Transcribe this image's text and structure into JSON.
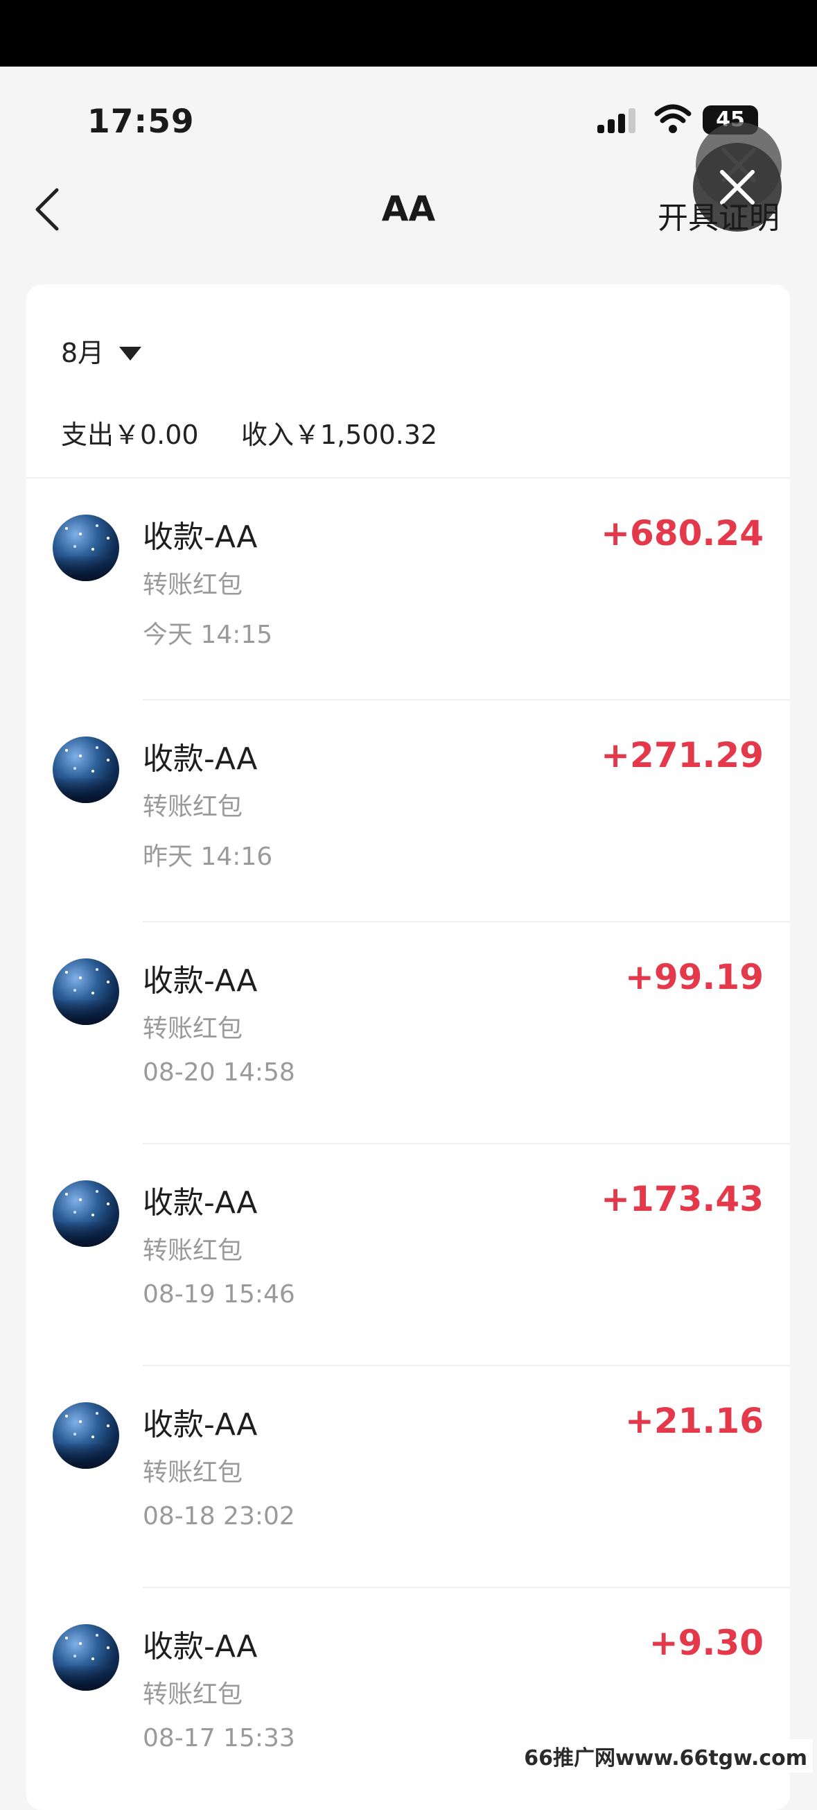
{
  "status_bar": {
    "time": "17:59",
    "battery": "45",
    "icons": [
      "signal-icon",
      "wifi-icon",
      "battery-icon"
    ]
  },
  "overlay": {
    "close_icon": "close-icon"
  },
  "nav": {
    "back_icon": "chevron-left-icon",
    "title": "AA",
    "action_label": "开具证明"
  },
  "filter": {
    "month_label": "8月",
    "caret_icon": "caret-down-icon"
  },
  "summary": {
    "expense": "支出￥0.00",
    "income": "收入￥1,500.32"
  },
  "transactions": [
    {
      "title": "收款-AA",
      "type": "转账红包",
      "time": "今天 14:15",
      "amount": "+680.24"
    },
    {
      "title": "收款-AA",
      "type": "转账红包",
      "time": "昨天 14:16",
      "amount": "+271.29"
    },
    {
      "title": "收款-AA",
      "type": "转账红包",
      "time": "08-20 14:58",
      "amount": "+99.19"
    },
    {
      "title": "收款-AA",
      "type": "转账红包",
      "time": "08-19 15:46",
      "amount": "+173.43"
    },
    {
      "title": "收款-AA",
      "type": "转账红包",
      "time": "08-18 23:02",
      "amount": "+21.16"
    },
    {
      "title": "收款-AA",
      "type": "转账红包",
      "time": "08-17 15:33",
      "amount": "+9.30"
    }
  ],
  "watermark": "66推广网www.66tgw.com",
  "colors": {
    "amount": "#e4394a",
    "secondary_text": "#9a9a9a",
    "background": "#f5f5f5"
  }
}
